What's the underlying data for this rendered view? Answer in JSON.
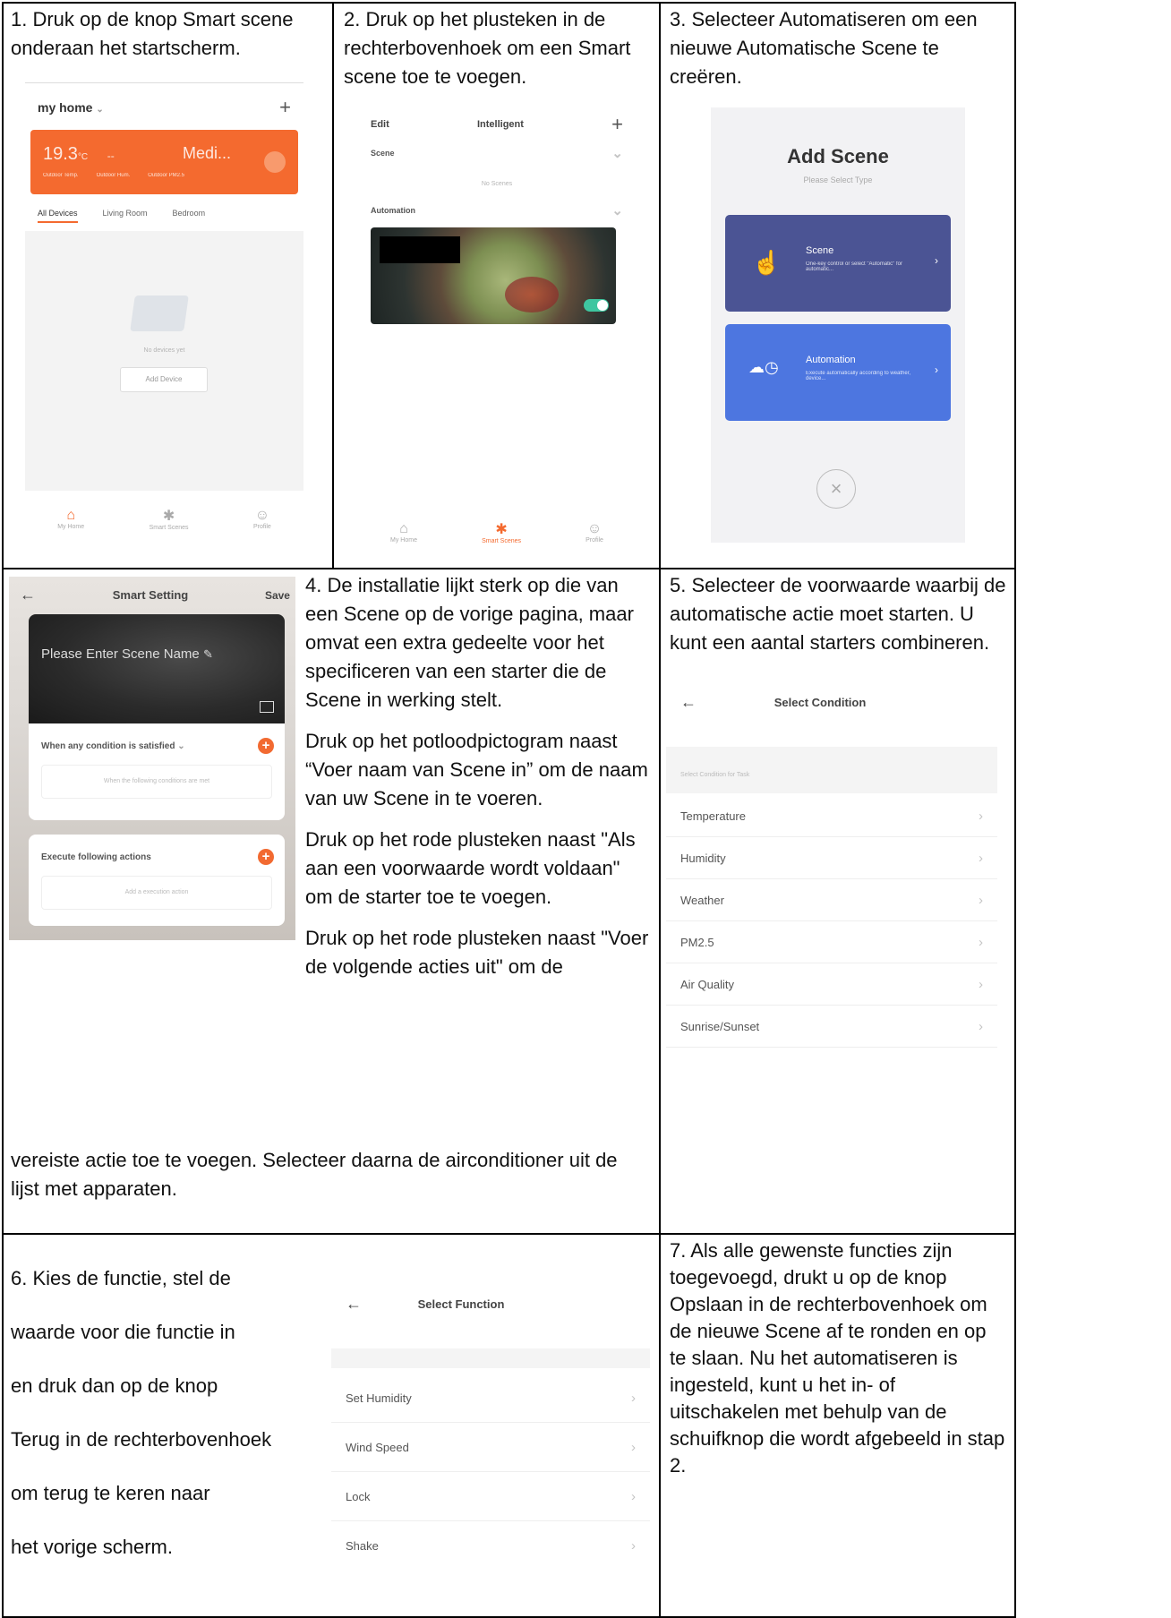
{
  "step1": {
    "text": "1. Druk op de knop Smart scene onderaan het startscherm.",
    "app": {
      "home_title": "my home",
      "weather_temp": "19.3",
      "weather_deg": "°C",
      "weather_quality": "Medi...",
      "weather_labels": [
        "Outdoor Temp.",
        "Outdoor Hum.",
        "Outdoor PM2.5"
      ],
      "tabs": [
        "All Devices",
        "Living Room",
        "Bedroom"
      ],
      "empty_text": "No devices yet",
      "add_device": "Add Device",
      "nav": [
        "My Home",
        "Smart Scenes",
        "Profile"
      ]
    }
  },
  "step2": {
    "text": "2. Druk op het plusteken in de rechterbovenhoek om een Smart scene toe te voegen.",
    "app": {
      "edit": "Edit",
      "title": "Intelligent",
      "scene": "Scene",
      "no_scenes": "No Scenes",
      "automation": "Automation",
      "nav": [
        "My Home",
        "Smart Scenes",
        "Profile"
      ]
    }
  },
  "step3": {
    "text": "3. Selecteer Automatiseren om een nieuwe Automatische Scene te creëren.",
    "app": {
      "title": "Add Scene",
      "subtitle": "Please Select Type",
      "scene_title": "Scene",
      "scene_desc": "One-key control or select \"Automatic\" for automatic...",
      "automation_title": "Automation",
      "automation_desc": "Execute automatically according to weather, device..."
    }
  },
  "step4": {
    "paragraphs": [
      "4. De installatie lijkt sterk op die van een Scene op de vorige pagina, maar omvat een extra gedeelte voor het specificeren van een starter die de Scene in werking stelt.",
      "Druk op het potloodpictogram naast “Voer naam van Scene in” om de naam van uw Scene in te voeren.",
      "Druk op het rode plusteken naast \"Als aan een voorwaarde wordt voldaan\" om de starter toe te voegen.",
      "Druk op het rode plusteken naast \"Voer de volgende acties uit\" om de"
    ],
    "continuation": "vereiste actie toe te voegen. Selecteer daarna de airconditioner uit de lijst met apparaten.",
    "app": {
      "title": "Smart Setting",
      "save": "Save",
      "name_placeholder": "Please Enter Scene Name",
      "condition_header": "When any condition is satisfied",
      "condition_placeholder": "When the following conditions are met",
      "action_header": "Execute following actions",
      "action_placeholder": "Add a execution action"
    }
  },
  "step5": {
    "text": "5. Selecteer de voorwaarde waarbij de automatische actie moet starten. U kunt een aantal starters combineren.",
    "app": {
      "title": "Select Condition",
      "section": "Select Condition for Task",
      "items": [
        "Temperature",
        "Humidity",
        "Weather",
        "PM2.5",
        "Air Quality",
        "Sunrise/Sunset"
      ]
    }
  },
  "step6": {
    "lines": [
      "6. Kies de functie, stel de",
      "waarde voor die functie in",
      "en druk dan op de knop",
      "Terug in de rechterbovenhoek",
      "om terug te keren naar",
      "het vorige scherm."
    ],
    "app": {
      "title": "Select Function",
      "items": [
        "Set Humidity",
        "Wind Speed",
        "Lock",
        "Shake"
      ]
    }
  },
  "step7": {
    "text": "7. Als alle gewenste functies zijn toegevoegd, drukt u op de knop Opslaan in de rechterbovenhoek om de nieuwe Scene af te ronden en op te slaan. Nu het automatiseren is ingesteld, kunt u het in- of uitschakelen met behulp van de schuifknop die wordt afgebeeld in stap 2."
  },
  "colors": {
    "orange": "#f46a2f",
    "scene_card": "#4b5494",
    "automation_card": "#4d76e0"
  }
}
